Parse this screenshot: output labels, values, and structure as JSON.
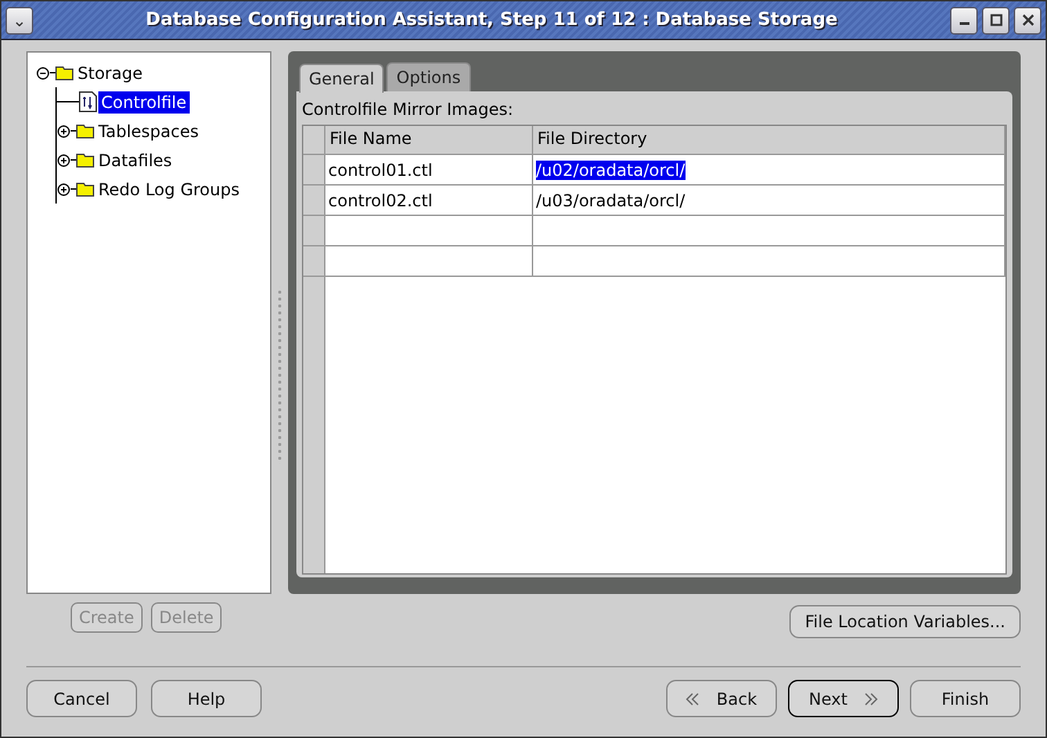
{
  "window": {
    "title": "Database Configuration Assistant, Step 11 of 12 : Database Storage",
    "menu_glyph": "⌄",
    "controls": [
      {
        "kind": "minimize"
      },
      {
        "kind": "maximize"
      },
      {
        "kind": "close"
      }
    ]
  },
  "tree": [
    {
      "label": "Storage",
      "kind": "folder",
      "expanded": true,
      "selected": false,
      "children": [
        {
          "label": "Controlfile",
          "kind": "document",
          "selected": true
        },
        {
          "label": "Tablespaces",
          "kind": "folder",
          "expanded": false,
          "selected": false
        },
        {
          "label": "Datafiles",
          "kind": "folder",
          "expanded": false,
          "selected": false
        },
        {
          "label": "Redo Log Groups",
          "kind": "folder",
          "expanded": false,
          "selected": false
        }
      ]
    }
  ],
  "tree_buttons": [
    {
      "label": "Create",
      "disabled": true
    },
    {
      "label": "Delete",
      "disabled": true
    }
  ],
  "tabs": [
    {
      "label": "General",
      "selected": true
    },
    {
      "label": "Options",
      "selected": false
    }
  ],
  "table": {
    "caption": "Controlfile Mirror Images:",
    "columns": [
      "File Name",
      "File Directory"
    ],
    "rows": [
      {
        "kind": "data",
        "cells": [
          {
            "text": "control01.ctl",
            "selected": false
          },
          {
            "text": "/u02/oradata/orcl/",
            "selected": true
          }
        ]
      },
      {
        "kind": "data",
        "cells": [
          {
            "text": "control02.ctl",
            "selected": false
          },
          {
            "text": "/u03/oradata/orcl/",
            "selected": false
          }
        ]
      },
      {
        "kind": "blank"
      },
      {
        "kind": "blank"
      }
    ]
  },
  "panel_button": {
    "label": "File Location Variables..."
  },
  "footer_left": [
    {
      "label": "Cancel"
    },
    {
      "label": "Help"
    }
  ],
  "footer_right": [
    {
      "label": "Back",
      "kind": "back",
      "default": false
    },
    {
      "label": "Next",
      "kind": "next",
      "default": true
    },
    {
      "label": "Finish",
      "kind": "plain",
      "default": false
    }
  ]
}
